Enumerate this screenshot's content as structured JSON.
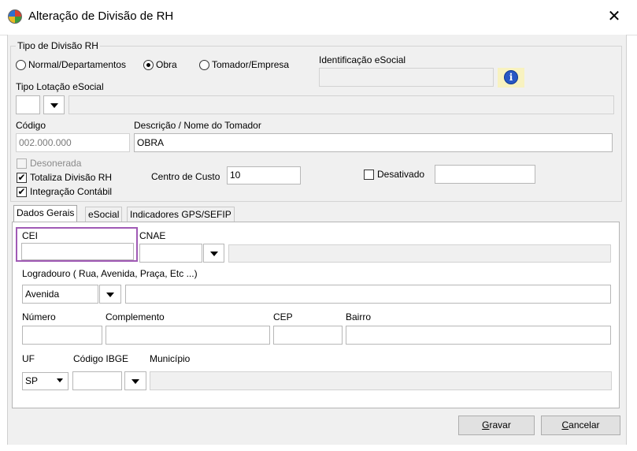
{
  "window": {
    "title": "Alteração de Divisão de RH"
  },
  "tipo_divisao": {
    "group_label": "Tipo de Divisão RH",
    "options": [
      {
        "label": "Normal/Departamentos",
        "selected": false
      },
      {
        "label": "Obra",
        "selected": true
      },
      {
        "label": "Tomador/Empresa",
        "selected": false
      }
    ]
  },
  "identificacao": {
    "label": "Identificação eSocial",
    "value": ""
  },
  "tipo_lotacao": {
    "label": "Tipo Lotação eSocial",
    "value": "",
    "description": ""
  },
  "codigo": {
    "label": "Código",
    "value": "002.000.000"
  },
  "descricao": {
    "label": "Descrição / Nome do Tomador",
    "value": "OBRA"
  },
  "desonerada": {
    "label": "Desonerada",
    "checked": false,
    "enabled": false
  },
  "totaliza": {
    "label": "Totaliza Divisão RH",
    "checked": true
  },
  "integracao": {
    "label": "Integração Contábil",
    "checked": true
  },
  "centro_custo": {
    "label": "Centro de Custo",
    "value": "10"
  },
  "desativado": {
    "label": "Desativado",
    "checked": false,
    "value": ""
  },
  "tabs": [
    "Dados Gerais",
    "eSocial",
    "Indicadores GPS/SEFIP"
  ],
  "dados_gerais": {
    "cei_label": "CEI",
    "cei_value": "",
    "cnae_label": "CNAE",
    "cnae_value": "",
    "cnae_desc": "",
    "logradouro_label": "Logradouro ( Rua, Avenida, Praça, Etc ...)",
    "logradouro_tipo": "Avenida",
    "logradouro_value": "",
    "numero_label": "Número",
    "numero_value": "",
    "complemento_label": "Complemento",
    "complemento_value": "",
    "cep_label": "CEP",
    "cep_value": "",
    "bairro_label": "Bairro",
    "bairro_value": "",
    "uf_label": "UF",
    "uf_value": "SP",
    "ibge_label": "Código IBGE",
    "ibge_value": "",
    "municipio_label": "Município",
    "municipio_value": ""
  },
  "buttons": {
    "gravar": "Gravar",
    "cancelar": "Cancelar"
  },
  "colors": {
    "highlight": "#a05ab5",
    "info": "#2857c5"
  }
}
